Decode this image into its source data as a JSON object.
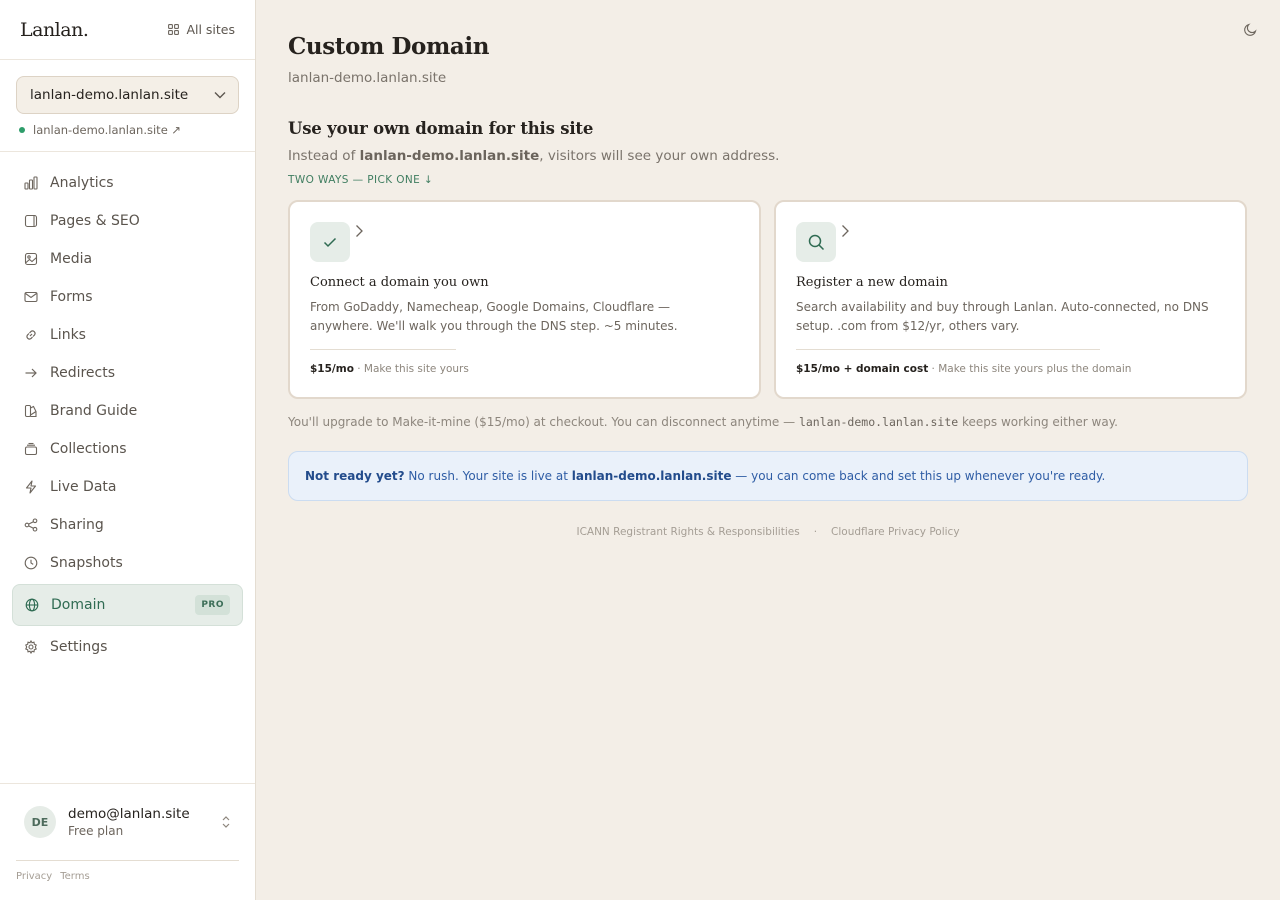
{
  "brand": {
    "logo": "Lanlan.",
    "all_sites": "All sites"
  },
  "site": {
    "selected": "lanlan-demo.lanlan.site",
    "link": "lanlan-demo.lanlan.site ↗"
  },
  "nav": {
    "items": [
      {
        "label": "Analytics",
        "icon": "bar-chart-icon"
      },
      {
        "label": "Pages & SEO",
        "icon": "page-icon"
      },
      {
        "label": "Media",
        "icon": "image-icon"
      },
      {
        "label": "Forms",
        "icon": "mail-icon"
      },
      {
        "label": "Links",
        "icon": "link-icon"
      },
      {
        "label": "Redirects",
        "icon": "arrow-right-icon"
      },
      {
        "label": "Brand Guide",
        "icon": "palette-icon"
      },
      {
        "label": "Collections",
        "icon": "collection-icon"
      },
      {
        "label": "Live Data",
        "icon": "bolt-icon"
      },
      {
        "label": "Sharing",
        "icon": "share-icon"
      },
      {
        "label": "Snapshots",
        "icon": "clock-icon"
      },
      {
        "label": "Domain",
        "icon": "globe-icon",
        "badge": "PRO",
        "active": true
      },
      {
        "label": "Settings",
        "icon": "gear-icon"
      }
    ]
  },
  "user": {
    "initials": "DE",
    "email": "demo@lanlan.site",
    "plan": "Free plan"
  },
  "legal": {
    "privacy": "Privacy",
    "terms": "Terms"
  },
  "page": {
    "title": "Custom Domain",
    "subtitle": "lanlan-demo.lanlan.site"
  },
  "section": {
    "title": "Use your own domain for this site",
    "desc_prefix": "Instead of ",
    "desc_domain": "lanlan-demo.lanlan.site",
    "desc_suffix": ", visitors will see your own address.",
    "pick": "TWO WAYS — PICK ONE ↓"
  },
  "cards": [
    {
      "title": "Connect a domain you own",
      "desc": "From GoDaddy, Namecheap, Google Domains, Cloudflare — anywhere. We'll walk you through the DNS step. ~5 minutes.",
      "price": "$15/mo",
      "price_note": " · Make this site yours",
      "icon": "check-icon"
    },
    {
      "title": "Register a new domain",
      "desc": "Search availability and buy through Lanlan. Auto-connected, no DNS setup. .com from $12/yr, others vary.",
      "price": "$15/mo + domain cost",
      "price_note": " · Make this site yours plus the domain",
      "icon": "search-icon"
    }
  ],
  "upgrade": {
    "prefix": "You'll upgrade to Make-it-mine ($15/mo) at checkout. You can disconnect anytime — ",
    "domain": "lanlan-demo.lanlan.site",
    "suffix": " keeps working either way."
  },
  "banner": {
    "lead": "Not ready yet?",
    "text1": " No rush. Your site is live at ",
    "domain": "lanlan-demo.lanlan.site",
    "text2": " — you can come back and set this up whenever you're ready."
  },
  "footer": {
    "icann": "ICANN Registrant Rights & Responsibilities",
    "sep": "·",
    "cloudflare": "Cloudflare Privacy Policy"
  },
  "colors": {
    "accent": "#2f6b52",
    "background": "#f3eee7",
    "banner": "#eaf1fa",
    "live_dot": "#2e9d6a"
  }
}
